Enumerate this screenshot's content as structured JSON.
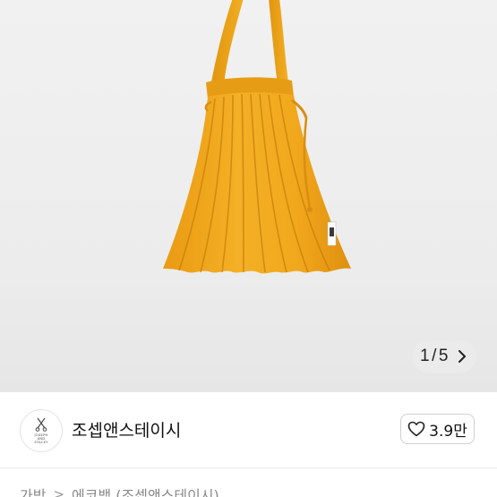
{
  "gallery": {
    "current": "1",
    "separator": "/",
    "total": "5",
    "background": "#eeeeee",
    "product_color": "#F2A91D"
  },
  "seller": {
    "name": "조셉앤스테이시",
    "logo_text": "JOSEPH\nAND\nSTACEY"
  },
  "like": {
    "count": "3.9만"
  },
  "breadcrumb": {
    "items": [
      "가방",
      "에코백 (조셉앤스테이시)"
    ],
    "separator": ">"
  },
  "icons": {
    "counter_next": "chevron-right-icon",
    "like": "heart-outline-icon",
    "logo": "scissors-logo-icon"
  }
}
